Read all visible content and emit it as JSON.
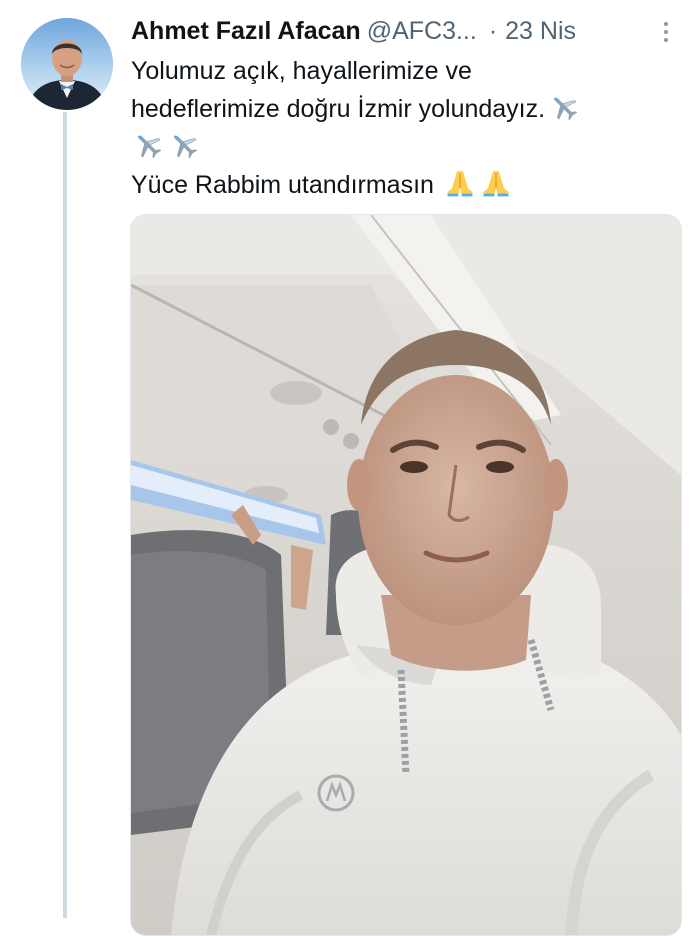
{
  "tweet": {
    "author": {
      "display_name": "Ahmet Fazıl Afacan",
      "handle": "@AFC3...",
      "avatar_icon": "profile-photo"
    },
    "separator": "·",
    "timestamp": "23 Nis",
    "more_icon": "more-vertical-icon",
    "text": {
      "line1": "Yolumuz açık, hayallerimize ve",
      "line2": "hedeflerimize doğru İzmir yolundayız.",
      "line4": "Yüce Rabbim utandırmasın"
    },
    "emojis": {
      "airplane": "airplane-emoji",
      "praying_hands": "folded-hands-emoji"
    },
    "media": {
      "type": "photo",
      "description_icon": "selfie-photo"
    }
  },
  "colors": {
    "text_primary": "#0f1419",
    "text_secondary": "#536471",
    "thread_line": "#cfd9de"
  }
}
